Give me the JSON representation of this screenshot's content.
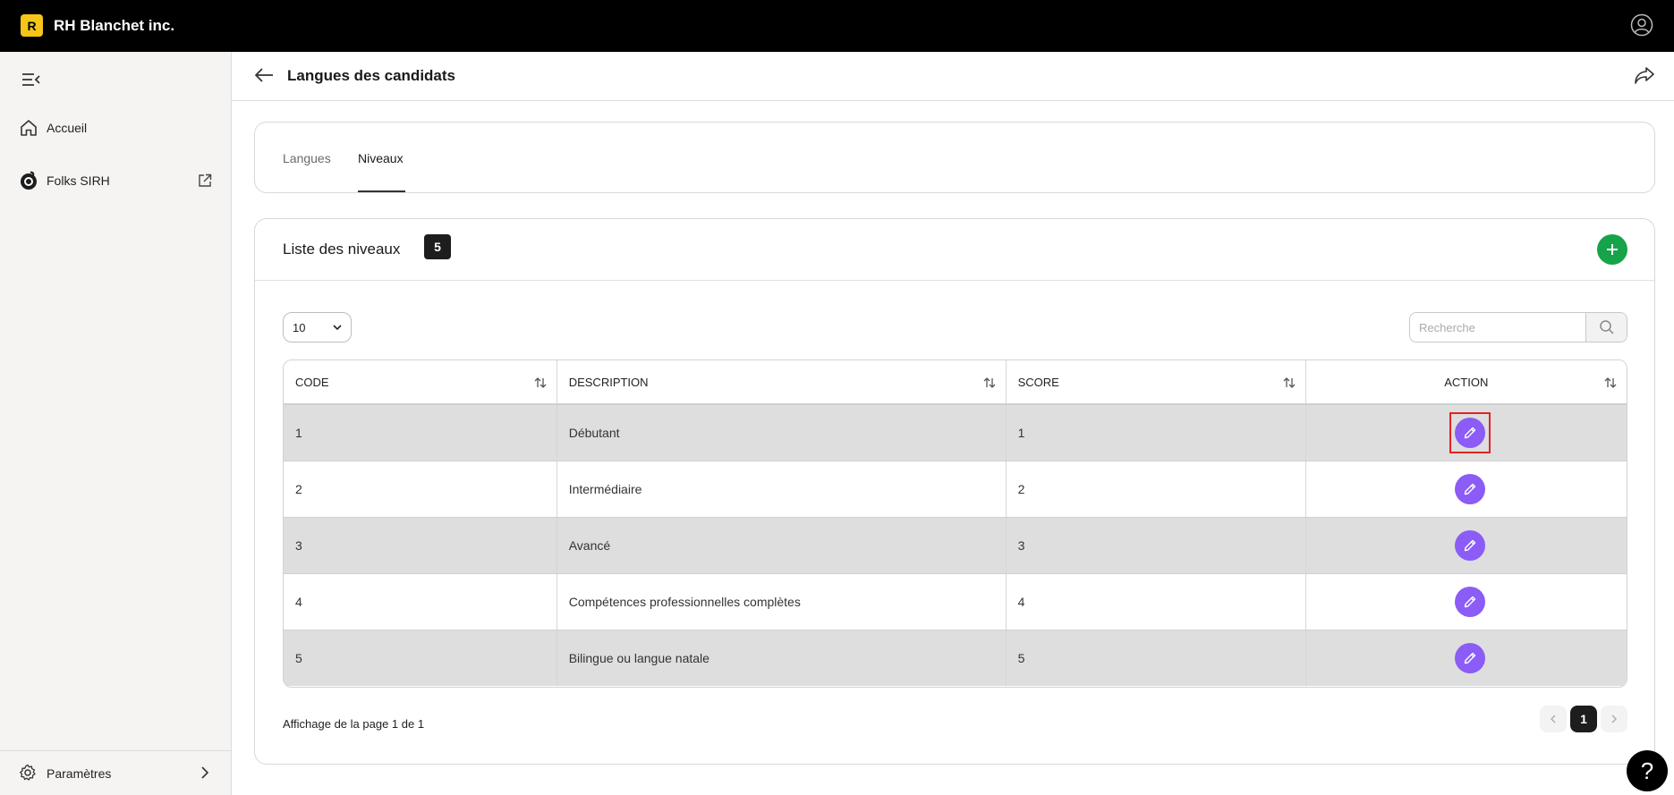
{
  "app": {
    "logo_letter": "R",
    "company": "RH Blanchet inc."
  },
  "sidebar": {
    "items": [
      {
        "label": "Accueil",
        "icon": "home-icon"
      },
      {
        "label": "Folks SIRH",
        "icon": "folks-logo-icon"
      }
    ],
    "bottom": {
      "label": "Paramètres",
      "icon": "gear-icon"
    }
  },
  "header": {
    "title": "Langues des candidats"
  },
  "tabs": [
    {
      "label": "Langues",
      "active": false
    },
    {
      "label": "Niveaux",
      "active": true
    }
  ],
  "list": {
    "title": "Liste des niveaux",
    "count": "5",
    "page_size": "10",
    "search_placeholder": "Recherche",
    "columns": [
      "CODE",
      "DESCRIPTION",
      "SCORE",
      "ACTION"
    ],
    "rows": [
      {
        "code": "1",
        "description": "Débutant",
        "score": "1"
      },
      {
        "code": "2",
        "description": "Intermédiaire",
        "score": "2"
      },
      {
        "code": "3",
        "description": "Avancé",
        "score": "3"
      },
      {
        "code": "4",
        "description": "Compétences professionnelles complètes",
        "score": "4"
      },
      {
        "code": "5",
        "description": "Bilingue ou langue natale",
        "score": "5"
      }
    ],
    "pagination_info": "Affichage de la page 1 de 1",
    "current_page": "1"
  },
  "help": {
    "label": "?"
  },
  "colors": {
    "accent_edit": "#8b5cf6",
    "accent_add": "#16a34a",
    "highlight": "#e02424"
  }
}
